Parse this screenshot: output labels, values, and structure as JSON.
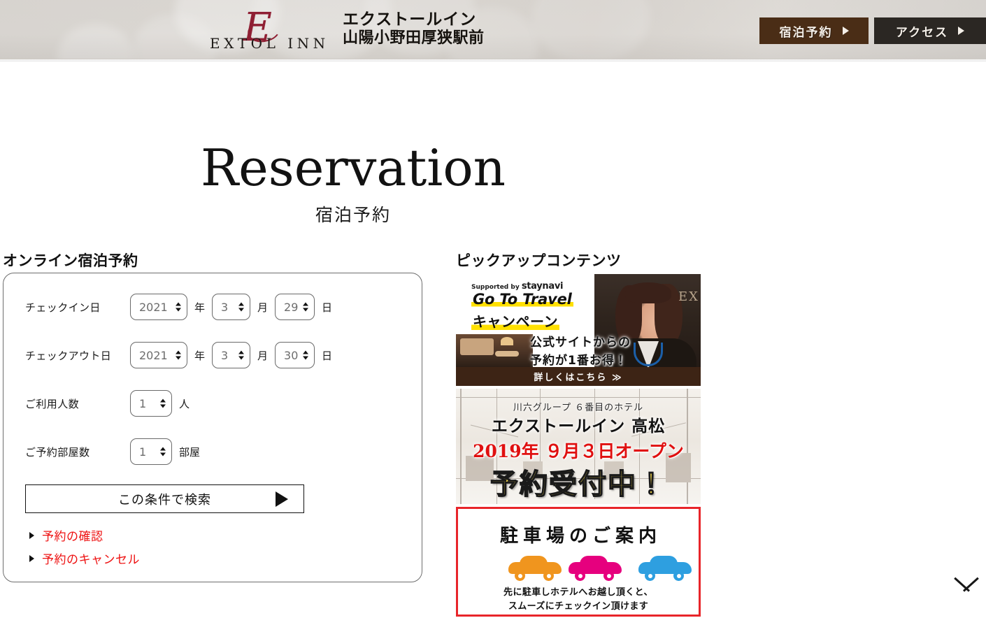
{
  "header": {
    "logo_script": "E",
    "logo_wordmark": "EXTOL INN",
    "hotel_name_line1": "エクストールイン",
    "hotel_name_line2": "山陽小野田厚狭駅前",
    "buttons": [
      {
        "label": "宿泊予約",
        "icon": "triangle-right-icon",
        "color": "#4a2d16"
      },
      {
        "label": "アクセス",
        "icon": "triangle-right-icon",
        "color": "#2b2723"
      }
    ]
  },
  "page": {
    "title": "Reservation",
    "subtitle": "宿泊予約"
  },
  "form": {
    "heading": "オンライン宿泊予約",
    "checkin": {
      "label": "チェックイン日",
      "year": "2021",
      "year_unit": "年",
      "month": "3",
      "month_unit": "月",
      "day": "29",
      "day_unit": "日"
    },
    "checkout": {
      "label": "チェックアウト日",
      "year": "2021",
      "year_unit": "年",
      "month": "3",
      "month_unit": "月",
      "day": "30",
      "day_unit": "日"
    },
    "guests": {
      "label": "ご利用人数",
      "value": "1",
      "unit": "人"
    },
    "rooms": {
      "label": "ご予約部屋数",
      "value": "1",
      "unit": "部屋"
    },
    "search_button": "この条件で検索",
    "links": [
      {
        "label": "予約の確認",
        "color": "#ee1111"
      },
      {
        "label": "予約のキャンセル",
        "color": "#ee1111"
      }
    ]
  },
  "pickup": {
    "heading": "ピックアップコンテンツ",
    "banners": [
      {
        "supported_prefix": "Supported by",
        "supported_brand": "staynavi",
        "title": "Go To Travel",
        "subtitle": "キャンペーン",
        "message": "公式サイトからの\n予約が1番お得！",
        "message_line1": "公式サイトからの",
        "message_line2": "予約が1番お得！",
        "cta": "詳しくはこちら ≫",
        "highlight_color": "#ffe000",
        "cta_bg": "#3d2415"
      },
      {
        "caption": "川六グループ ６番目のホテル",
        "hotel": "エクストールイン 高松",
        "open_date": "2019年 ９月３日オープン",
        "status": "予約受付中！",
        "open_date_color": "#e01010",
        "status_color": "#ffe14d"
      },
      {
        "title": "駐車場のご案内",
        "note_line1": "先に駐車しホテルへお越し頂くと、",
        "note_line2": "スムーズにチェックイン頂けます",
        "border_color": "#e8252a",
        "car_colors": [
          "#f0951e",
          "#e6007e",
          "#2e9fe0"
        ]
      }
    ]
  },
  "to_top": {
    "icon": "chevron-up-icon"
  }
}
